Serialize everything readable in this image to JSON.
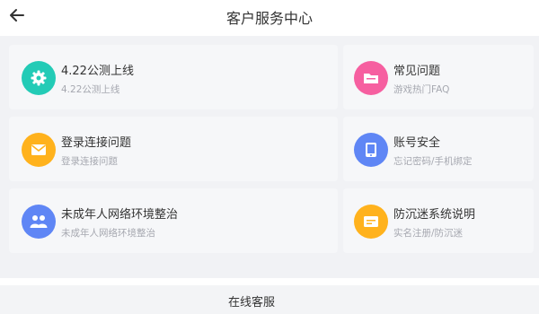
{
  "header": {
    "title": "客户服务中心",
    "back_icon": "back-arrow-icon"
  },
  "cards": [
    {
      "title": "4.22公测上线",
      "subtitle": "4.22公测上线",
      "icon": "gear-icon",
      "color": "#23cbb6"
    },
    {
      "title": "常见问题",
      "subtitle": "游戏热门FAQ",
      "icon": "folder-icon",
      "color": "#f65fa0"
    },
    {
      "title": "登录连接问题",
      "subtitle": "登录连接问题",
      "icon": "mail-icon",
      "color": "#ffb21d"
    },
    {
      "title": "账号安全",
      "subtitle": "忘记密码/手机绑定",
      "icon": "tablet-icon",
      "color": "#5f86f5"
    },
    {
      "title": "未成年人网络环境整治",
      "subtitle": "未成年人网络环境整治",
      "icon": "group-icon",
      "color": "#5f86f5"
    },
    {
      "title": "防沉迷系统说明",
      "subtitle": "实名注册/防沉迷",
      "icon": "id-card-icon",
      "color": "#ffb21d"
    }
  ],
  "footer": {
    "label": "在线客服"
  }
}
